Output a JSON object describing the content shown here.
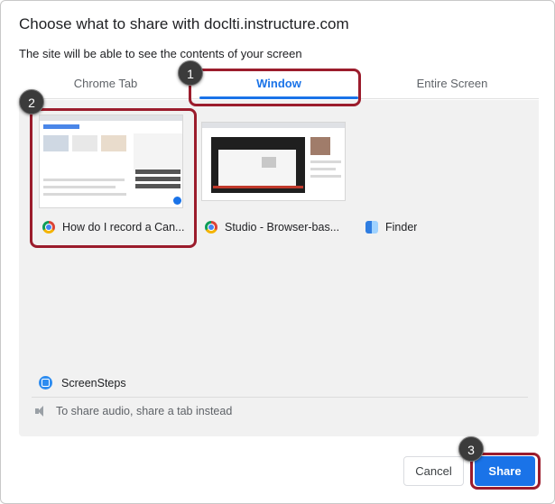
{
  "dialog": {
    "title": "Choose what to share with doclti.instructure.com",
    "subtitle": "The site will be able to see the contents of your screen"
  },
  "tabs": [
    {
      "label": "Chrome Tab",
      "active": false
    },
    {
      "label": "Window",
      "active": true
    },
    {
      "label": "Entire Screen",
      "active": false
    }
  ],
  "windows": [
    {
      "label": "How do I record a Can...",
      "icon": "chrome-icon",
      "selected": true
    },
    {
      "label": "Studio - Browser-bas...",
      "icon": "chrome-icon",
      "selected": false
    },
    {
      "label": "Finder",
      "icon": "finder-icon",
      "selected": false
    }
  ],
  "extra_window": {
    "label": "ScreenSteps",
    "icon": "screensteps-icon"
  },
  "audio_note": "To share audio, share a tab instead",
  "buttons": {
    "cancel": "Cancel",
    "share": "Share"
  },
  "callouts": [
    "1",
    "2",
    "3"
  ],
  "colors": {
    "accent": "#1a73e8",
    "highlight": "#9b1c2c",
    "callout": "#3b3b3b"
  }
}
